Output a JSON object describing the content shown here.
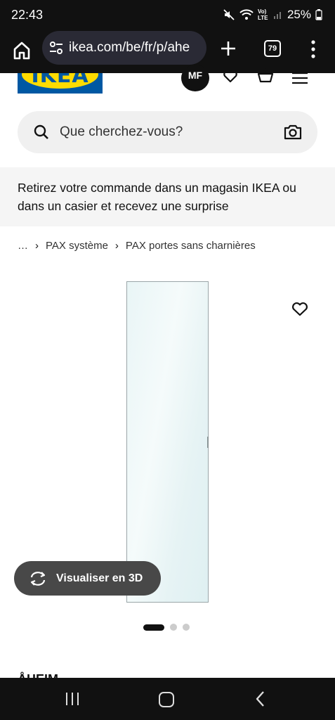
{
  "status_bar": {
    "time": "22:43",
    "network": "Vo) LTE",
    "battery": "25%"
  },
  "browser": {
    "url": "ikea.com/be/fr/p/ahe",
    "tab_count": "79"
  },
  "header": {
    "logo_text": "IKEA",
    "avatar_initials": "MF"
  },
  "search": {
    "placeholder": "Que cherchez-vous?"
  },
  "banner": {
    "text": "Retirez votre commande dans un magasin IKEA ou dans un casier et recevez une surprise"
  },
  "breadcrumb": {
    "ellipsis": "…",
    "items": [
      {
        "label": "PAX système"
      },
      {
        "label": "PAX portes sans charnières"
      }
    ]
  },
  "product": {
    "view_3d_label": "Visualiser en 3D",
    "carousel": {
      "current": 1,
      "total": 3
    },
    "name_peek": "ÅHEIM"
  },
  "colors": {
    "ikea_blue": "#0058a3",
    "ikea_yellow": "#ffdb00",
    "system_bar": "#111111",
    "view_3d_bg": "#484848"
  }
}
